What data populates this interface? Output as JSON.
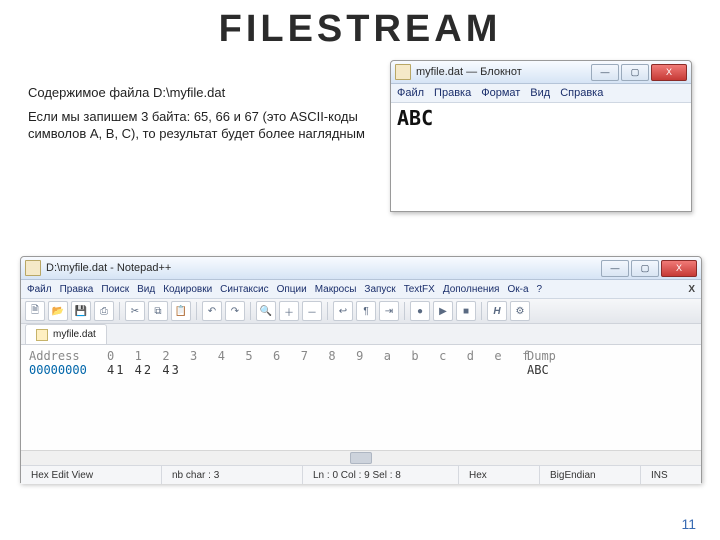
{
  "slide": {
    "title": "FILESTREAM",
    "page_number": "11"
  },
  "description": {
    "line1": "Содержимое файла D:\\myfile.dat",
    "line2": "Если мы запишем 3 байта: 65, 66 и 67 (это ASCII-коды символов A, B, C), то результат будет более наглядным"
  },
  "notepad": {
    "title": "myfile.dat — Блокнот",
    "menu": [
      "Файл",
      "Правка",
      "Формат",
      "Вид",
      "Справка"
    ],
    "content": "ABC",
    "buttons": {
      "min": "—",
      "max": "▢",
      "close": "X"
    }
  },
  "npp": {
    "title": "D:\\myfile.dat - Notepad++",
    "menu": [
      "Файл",
      "Правка",
      "Поиск",
      "Вид",
      "Кодировки",
      "Синтаксис",
      "Опции",
      "Макросы",
      "Запуск",
      "TextFX",
      "Дополнения",
      "Ок-а",
      "?"
    ],
    "tab_label": "myfile.dat",
    "hex": {
      "header_addr": "Address",
      "header_cols": "0  1  2  3  4  5  6  7  8  9  a  b  c  d  e  f",
      "header_dump": "Dump",
      "row_addr": "00000000",
      "row_bytes": "41 42 43",
      "row_dump": "ABC"
    },
    "status": {
      "view": "Hex Edit View",
      "chars": "nb char : 3",
      "pos": "Ln : 0   Col : 9   Sel : 8",
      "mode": "Hex",
      "endian": "BigEndian",
      "ins": "INS"
    },
    "buttons": {
      "min": "—",
      "max": "▢",
      "close": "X"
    }
  }
}
